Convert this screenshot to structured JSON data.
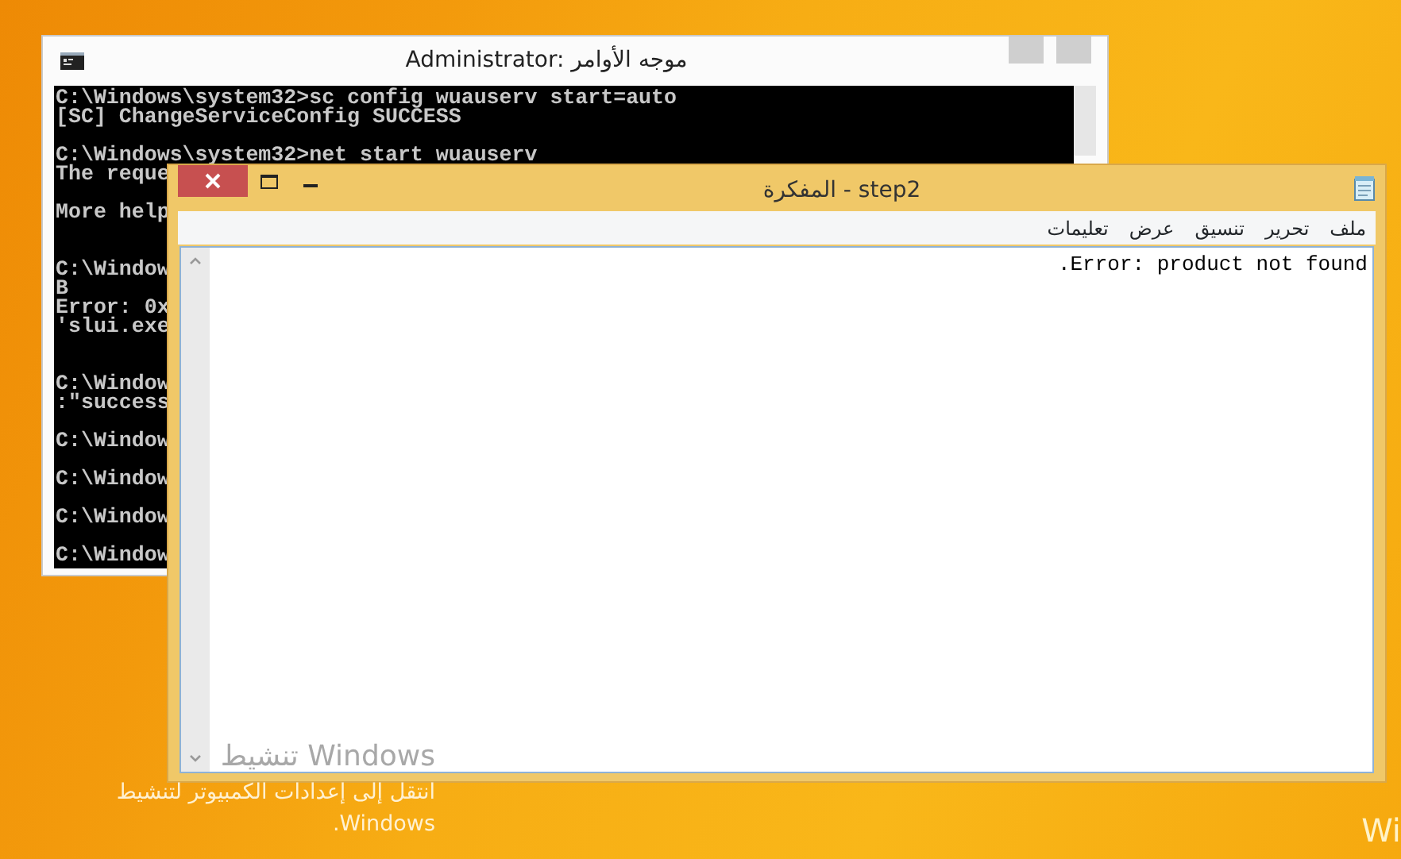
{
  "desktop": {
    "corner_text": "Wi"
  },
  "cmd_window": {
    "title": "Administrator: موجه الأوامر",
    "active": false,
    "output": "C:\\Windows\\system32>sc config wuauserv start=auto\n[SC] ChangeServiceConfig SUCCESS\n\nC:\\Windows\\system32>net start wuauserv\nThe reque\n\nMore help\n\n\nC:\\Window\nB\nError: 0x\n'slui.exe\n\n\nC:\\Window\n:\"success\n\nC:\\Window\n\nC:\\Window\n\nC:\\Window\n\nC:\\Window"
  },
  "notepad": {
    "title": "المفكرة - step2",
    "active": true,
    "menu": [
      "ملف",
      "تحرير",
      "تنسيق",
      "عرض",
      "تعليمات"
    ],
    "content": ".Error: product not found"
  },
  "activation_notice": {
    "heading": "تنشيط Windows",
    "lines": [
      "انتقل إلى إعدادات الكمبيوتر لتنشيط",
      ".Windows"
    ]
  }
}
